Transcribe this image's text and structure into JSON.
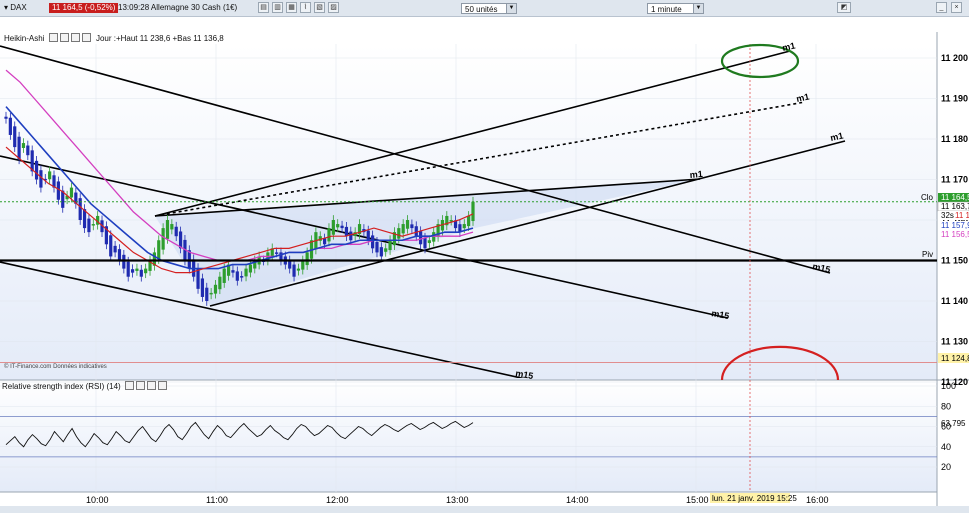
{
  "window": {
    "instrument": "DAX",
    "price_badge": "11 164,5 (-0,52%)",
    "subtitle": "13:09:28 Allemagne 30 Cash (1€)",
    "units_select": "50 unités",
    "interval_select": "1 minute"
  },
  "info_bar": {
    "chart_style": "Heikin-Ashi",
    "stats": "Jour :+Haut 11 238,6 +Bas 11 136,8"
  },
  "rsi_panel": {
    "title": "Relative strength index (RSI) (14)",
    "value_label": "63,795"
  },
  "source_note": "© IT-Finance.com  Données indicatives",
  "price_labels": {
    "clo": "Clo",
    "clo_value": "11 164,5",
    "ma1": "11 163,7",
    "timer": "32s",
    "ma2": "11 160,6",
    "ma3": "11 157,9",
    "ma4": "11 156,5",
    "piv": "Piv",
    "piv_value": "11 150",
    "level_red": "11 124,8"
  },
  "annotations": {
    "m1_a": "m1",
    "m1_b": "m1",
    "m1_c": "m1",
    "m1_d": "m1",
    "m15_a": "m15",
    "m15_b": "m15",
    "m15_c": "m15"
  },
  "crosshair_time": "lun. 21 janv. 2019 15:25",
  "colors": {
    "up": "#2e9e2e",
    "down": "#1f2bb0",
    "red_ma": "#d42020",
    "blue_ma": "#1f3fc0",
    "magenta_ma": "#d43fc0",
    "wedge_fill": "#cfdbf2",
    "background_top": "#ffffff",
    "background_bottom": "#e4ebf8",
    "green_circle": "#1f7a1f",
    "red_arc": "#d42020",
    "rsi_line": "#111111",
    "price_badge": "#c81e1e"
  },
  "chart_data": [
    {
      "type": "line",
      "series_style": "heikin-ashi candles with moving averages",
      "x_ticks": [
        "10:00",
        "11:00",
        "12:00",
        "13:00",
        "14:00",
        "15:00",
        "16:00"
      ],
      "y_ticks": [
        "11 200",
        "11 190",
        "11 180",
        "11 170",
        "11 160",
        "11 150",
        "11 140",
        "11 130",
        "11 120"
      ],
      "ylim": [
        11117,
        11220
      ],
      "x_range": [
        "09:22",
        "16:30"
      ],
      "candles_close": [
        11185,
        11181,
        11178,
        11175,
        11179,
        11176,
        11172,
        11170,
        11168,
        11170,
        11172,
        11168,
        11165,
        11163,
        11166,
        11168,
        11164,
        11160,
        11158,
        11157,
        11159,
        11161,
        11157,
        11154,
        11151,
        11152,
        11150,
        11148,
        11146,
        11147,
        11148,
        11146,
        11148,
        11150,
        11152,
        11155,
        11158,
        11160,
        11159,
        11156,
        11153,
        11150,
        11148,
        11146,
        11143,
        11141,
        11140,
        11142,
        11144,
        11146,
        11148,
        11149,
        11147,
        11145,
        11146,
        11148,
        11149,
        11150,
        11151,
        11150,
        11152,
        11153,
        11152,
        11150,
        11149,
        11148,
        11146,
        11148,
        11150,
        11152,
        11155,
        11157,
        11156,
        11154,
        11158,
        11160,
        11159,
        11158,
        11156,
        11155,
        11157,
        11159,
        11157,
        11155,
        11153,
        11152,
        11151,
        11153,
        11155,
        11157,
        11158,
        11159,
        11160,
        11158,
        11156,
        11154,
        11153,
        11155,
        11157,
        11159,
        11160,
        11161,
        11160,
        11158,
        11157,
        11159,
        11161,
        11164.5
      ],
      "ma_red": [
        11178,
        11175,
        11172,
        11169,
        11167,
        11164,
        11161,
        11158,
        11155,
        11152,
        11150,
        11148,
        11147,
        11147,
        11148,
        11149,
        11150,
        11151,
        11152,
        11153,
        11153,
        11154,
        11155,
        11156,
        11156,
        11157,
        11158,
        11157,
        11156,
        11157,
        11158,
        11159,
        11160,
        11161.5
      ],
      "ma_blue": [
        11188,
        11184,
        11180,
        11176,
        11172,
        11168,
        11164,
        11161,
        11158,
        11155,
        11152,
        11150,
        11149,
        11148,
        11148,
        11148,
        11149,
        11149,
        11150,
        11151,
        11152,
        11152,
        11153,
        11154,
        11154,
        11155,
        11155,
        11155,
        11155,
        11156,
        11156,
        11157,
        11157,
        11158
      ],
      "ma_magenta": [
        11197,
        11194,
        11190,
        11186,
        11182,
        11178,
        11174,
        11170,
        11166,
        11162,
        11159,
        11156,
        11154,
        11152,
        11151,
        11150,
        11150,
        11150,
        11151,
        11151,
        11152,
        11152,
        11153,
        11153,
        11154,
        11154,
        11155,
        11155,
        11155,
        11155,
        11156,
        11156,
        11156,
        11157
      ],
      "horizontal_levels": {
        "pivot": 11150,
        "close": 11164.5,
        "red_level": 11124.8
      }
    },
    {
      "type": "line",
      "title": "Relative strength index (RSI) (14)",
      "y_ticks": [
        "100",
        "80",
        "60",
        "40",
        "20"
      ],
      "ylim": [
        0,
        100
      ],
      "bands": [
        30,
        70
      ],
      "last_value": 63.795,
      "values": [
        42,
        46,
        50,
        44,
        40,
        47,
        52,
        48,
        43,
        41,
        47,
        55,
        50,
        45,
        52,
        58,
        50,
        44,
        40,
        46,
        53,
        49,
        44,
        42,
        48,
        55,
        51,
        46,
        44,
        50,
        56,
        60,
        54,
        48,
        45,
        51,
        58,
        62,
        57,
        50,
        47,
        53,
        60,
        64,
        58,
        52,
        48,
        55,
        61,
        57,
        51,
        49,
        54,
        59,
        63,
        58,
        54,
        50,
        52,
        57,
        61,
        56,
        53,
        49,
        47,
        52,
        58,
        62,
        60,
        55,
        51,
        53,
        57,
        61,
        59,
        54,
        50,
        48,
        52,
        56,
        60,
        58,
        54,
        51,
        55,
        59,
        62,
        60,
        57,
        55,
        58,
        61,
        63,
        60,
        57,
        59,
        62,
        64,
        61,
        58,
        60,
        63,
        65,
        62,
        59,
        61,
        63.8
      ]
    }
  ]
}
